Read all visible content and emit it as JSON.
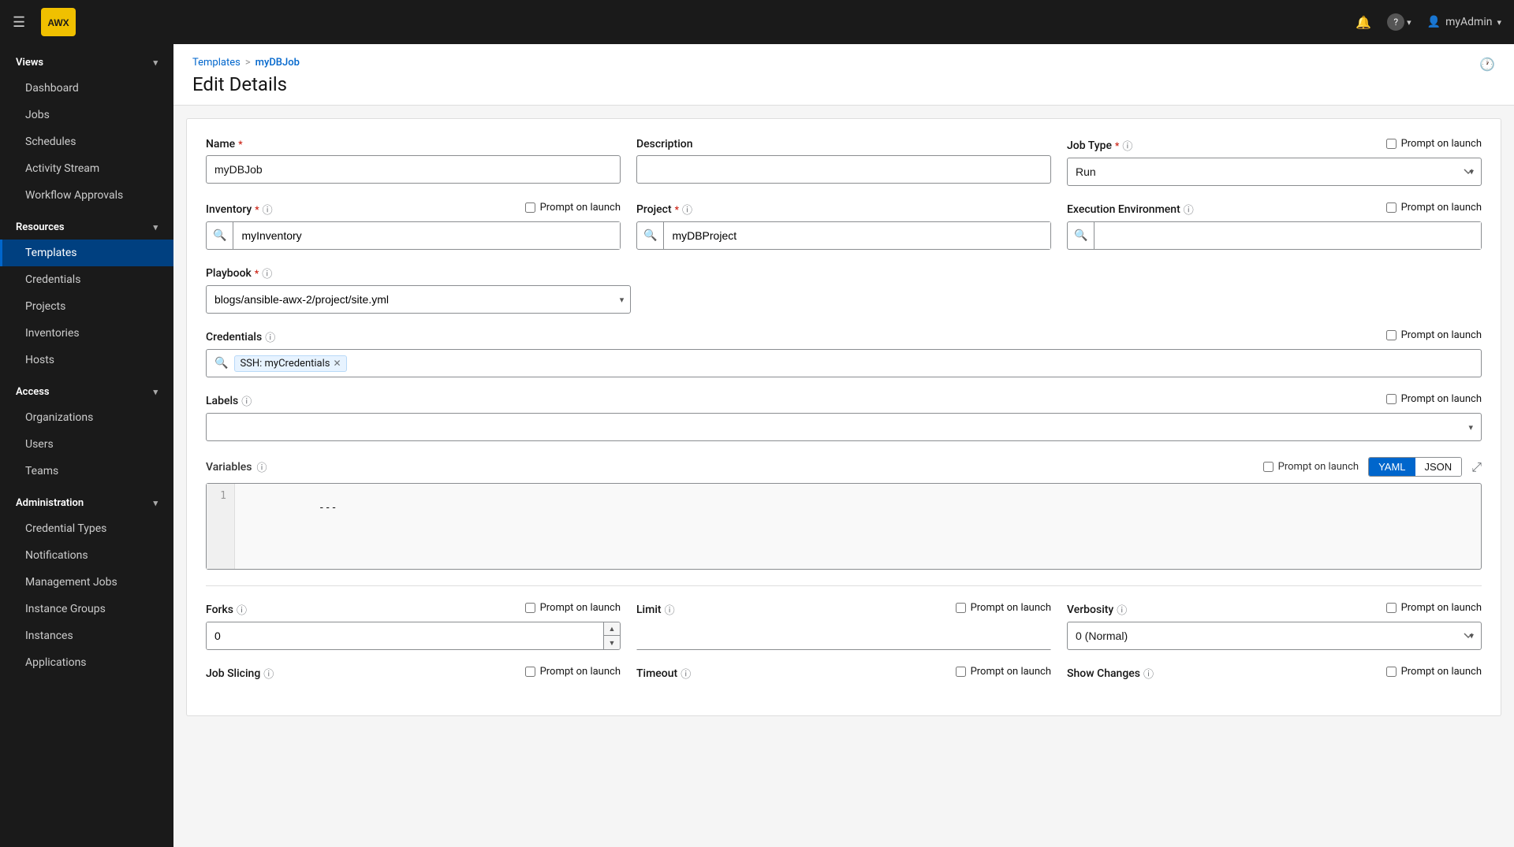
{
  "navbar": {
    "hamburger_label": "☰",
    "logo_text": "AWX",
    "notification_icon": "🔔",
    "help_icon": "?",
    "user_name": "myAdmin",
    "user_caret": "▾",
    "history_icon": "🕐"
  },
  "sidebar": {
    "views_label": "Views",
    "views_chevron": "▾",
    "views_items": [
      {
        "id": "dashboard",
        "label": "Dashboard"
      },
      {
        "id": "jobs",
        "label": "Jobs"
      },
      {
        "id": "schedules",
        "label": "Schedules"
      },
      {
        "id": "activity-stream",
        "label": "Activity Stream"
      },
      {
        "id": "workflow-approvals",
        "label": "Workflow Approvals"
      }
    ],
    "resources_label": "Resources",
    "resources_chevron": "▾",
    "resources_items": [
      {
        "id": "templates",
        "label": "Templates",
        "active": true
      },
      {
        "id": "credentials",
        "label": "Credentials"
      },
      {
        "id": "projects",
        "label": "Projects"
      },
      {
        "id": "inventories",
        "label": "Inventories"
      },
      {
        "id": "hosts",
        "label": "Hosts"
      }
    ],
    "access_label": "Access",
    "access_chevron": "▾",
    "access_items": [
      {
        "id": "organizations",
        "label": "Organizations"
      },
      {
        "id": "users",
        "label": "Users"
      },
      {
        "id": "teams",
        "label": "Teams"
      }
    ],
    "administration_label": "Administration",
    "administration_chevron": "▾",
    "administration_items": [
      {
        "id": "credential-types",
        "label": "Credential Types"
      },
      {
        "id": "notifications",
        "label": "Notifications"
      },
      {
        "id": "management-jobs",
        "label": "Management Jobs"
      },
      {
        "id": "instance-groups",
        "label": "Instance Groups"
      },
      {
        "id": "instances",
        "label": "Instances"
      },
      {
        "id": "applications",
        "label": "Applications"
      }
    ]
  },
  "breadcrumb": {
    "parent_label": "Templates",
    "separator": ">",
    "current_label": "myDBJob"
  },
  "page": {
    "title": "Edit Details"
  },
  "form": {
    "name_label": "Name",
    "name_required": "*",
    "name_value": "myDBJob",
    "description_label": "Description",
    "description_value": "",
    "job_type_label": "Job Type",
    "job_type_required": "*",
    "job_type_value": "Run",
    "job_type_prompt": "Prompt on launch",
    "inventory_label": "Inventory",
    "inventory_required": "*",
    "inventory_value": "myInventory",
    "inventory_prompt": "Prompt on launch",
    "project_label": "Project",
    "project_required": "*",
    "project_value": "myDBProject",
    "project_prompt": "Prompt on launch",
    "execution_env_label": "Execution Environment",
    "execution_env_value": "",
    "execution_env_prompt": "Prompt on launch",
    "playbook_label": "Playbook",
    "playbook_required": "*",
    "playbook_value": "blogs/ansible-awx-2/project/site.yml",
    "credentials_label": "Credentials",
    "credentials_prompt": "Prompt on launch",
    "credential_tag_label": "SSH: myCredentials",
    "labels_label": "Labels",
    "labels_prompt": "Prompt on launch",
    "variables_label": "Variables",
    "variables_prompt": "Prompt on launch",
    "yaml_tab": "YAML",
    "json_tab": "JSON",
    "code_line_1": "1",
    "code_value": "---",
    "forks_label": "Forks",
    "forks_value": "0",
    "forks_prompt": "Prompt on launch",
    "limit_label": "Limit",
    "limit_value": "",
    "limit_prompt": "Prompt on launch",
    "verbosity_label": "Verbosity",
    "verbosity_value": "0 (Normal)",
    "verbosity_prompt": "Prompt on launch",
    "job_slicing_label": "Job Slicing",
    "job_slicing_prompt": "Prompt on launch",
    "timeout_label": "Timeout",
    "timeout_prompt": "Prompt on launch",
    "show_changes_label": "Show Changes",
    "show_changes_prompt": "Prompt on launch"
  },
  "icons": {
    "search": "🔍",
    "remove": "✕",
    "expand": "⤢",
    "dropdown_arrow": "▾",
    "up_arrow": "▲",
    "down_arrow": "▼",
    "question_mark": "?"
  }
}
